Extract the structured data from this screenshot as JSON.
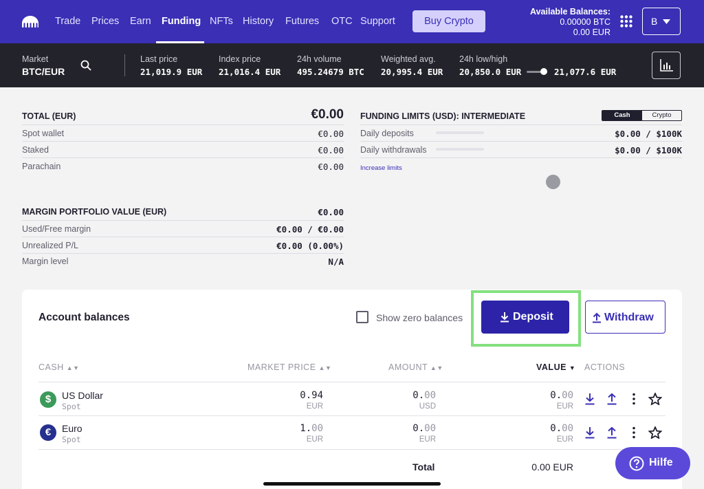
{
  "nav": {
    "items": [
      "Trade",
      "Prices",
      "Earn",
      "Funding",
      "NFTs",
      "History",
      "Futures",
      "OTC",
      "Support"
    ],
    "active": "Funding",
    "buy_button": "Buy Crypto",
    "balances_title": "Available Balances:",
    "balance_btc": "0.00000 BTC",
    "balance_eur": "0.00 EUR",
    "account_initial": "B",
    "icons": [
      "kraken-logo-icon",
      "apps-grid-icon",
      "caret-down-icon"
    ]
  },
  "market": {
    "market_label": "Market",
    "pair": "BTC/EUR",
    "stats": [
      {
        "label": "Last price",
        "value": "21,019.9 EUR"
      },
      {
        "label": "Index price",
        "value": "21,016.4 EUR"
      },
      {
        "label": "24h volume",
        "value": "495.24679 BTC"
      },
      {
        "label": "Weighted avg.",
        "value": "20,995.4 EUR"
      },
      {
        "label": "24h low/high",
        "low": "20,850.0 EUR",
        "high": "21,077.6 EUR"
      }
    ],
    "icons": [
      "search-icon",
      "chart-icon"
    ]
  },
  "totals": {
    "title": "TOTAL (EUR)",
    "total": "€0.00",
    "rows": [
      {
        "label": "Spot wallet",
        "value": "€0.00"
      },
      {
        "label": "Staked",
        "value": "€0.00"
      },
      {
        "label": "Parachain",
        "value": "€0.00"
      }
    ]
  },
  "limits": {
    "title": "FUNDING LIMITS (USD): INTERMEDIATE",
    "toggle": [
      "Cash",
      "Crypto"
    ],
    "rows": [
      {
        "label": "Daily deposits",
        "value": "$0.00  /  $100K"
      },
      {
        "label": "Daily withdrawals",
        "value": "$0.00  /  $100K"
      }
    ],
    "link": "Increase limits"
  },
  "margin": {
    "title": "MARGIN PORTFOLIO VALUE (EUR)",
    "title_value": "€0.00",
    "rows": [
      {
        "label": "Used/Free margin",
        "value": "€0.00 / €0.00"
      },
      {
        "label": "Unrealized P/L",
        "value": "€0.00 (0.00%)"
      },
      {
        "label": "Margin level",
        "value": "N/A"
      }
    ]
  },
  "balances": {
    "title": "Account balances",
    "show_zero": "Show zero balances",
    "deposit": "Deposit",
    "withdraw": "Withdraw",
    "columns": [
      "CASH",
      "MARKET PRICE",
      "AMOUNT",
      "VALUE",
      "ACTIONS"
    ],
    "rows": [
      {
        "name": "US Dollar",
        "type": "Spot",
        "symbol": "$",
        "color": "#3c9a5a",
        "price_int": "0.94",
        "price_dec": "",
        "price_unit": "EUR",
        "amount_int": "0.",
        "amount_dec": "00",
        "amount_unit": "USD",
        "value_int": "0.",
        "value_dec": "00",
        "value_unit": "EUR"
      },
      {
        "name": "Euro",
        "type": "Spot",
        "symbol": "€",
        "color": "#26308f",
        "price_int": "1.",
        "price_dec": "00",
        "price_unit": "EUR",
        "amount_int": "0.",
        "amount_dec": "00",
        "amount_unit": "EUR",
        "value_int": "0.",
        "value_dec": "00",
        "value_unit": "EUR"
      }
    ],
    "total_label": "Total",
    "total_value": "0.00 EUR"
  },
  "help": {
    "label": "Hilfe"
  },
  "colors": {
    "nav": "#3a2fb5",
    "marketbar": "#23232b",
    "deposit": "#2c23a8",
    "highlight": "#84e07f",
    "help": "#5b4ad9"
  }
}
